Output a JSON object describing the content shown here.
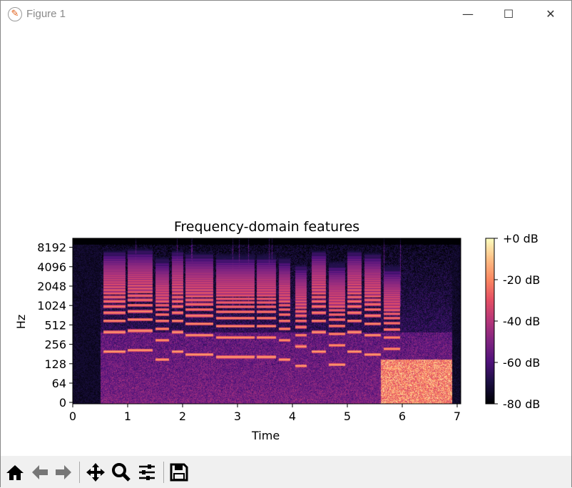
{
  "window": {
    "title": "Figure 1",
    "app_icon": "matplotlib-icon",
    "controls": [
      "minimize",
      "maximize",
      "close"
    ]
  },
  "toolbar": {
    "buttons": [
      "home-icon",
      "back-icon",
      "forward-icon",
      "pan-icon",
      "zoom-icon",
      "configure-subplots-icon",
      "save-icon"
    ]
  },
  "chart_data": {
    "type": "heatmap",
    "title": "Frequency-domain features",
    "xlabel": "Time",
    "ylabel": "Hz",
    "xlim": [
      0,
      7.06
    ],
    "ylim": [
      0,
      11025
    ],
    "yscale": "log (linear below 64)",
    "xticks": [
      "0",
      "1",
      "2",
      "3",
      "4",
      "5",
      "6",
      "7"
    ],
    "yticks": [
      "0",
      "64",
      "128",
      "256",
      "512",
      "1024",
      "2048",
      "4096",
      "8192"
    ],
    "colormap": "magma",
    "colorbar": {
      "range_db": [
        -80,
        0
      ],
      "ticks": [
        "+0 dB",
        "-20 dB",
        "-40 dB",
        "-60 dB",
        "-80 dB"
      ]
    },
    "note_segments": [
      {
        "start": 0.55,
        "end": 0.95,
        "f0_hz": 200
      },
      {
        "start": 1.0,
        "end": 1.45,
        "f0_hz": 210
      },
      {
        "start": 1.5,
        "end": 1.75,
        "f0_hz": 150
      },
      {
        "start": 1.8,
        "end": 2.0,
        "f0_hz": 200
      },
      {
        "start": 2.05,
        "end": 2.55,
        "f0_hz": 180
      },
      {
        "start": 2.6,
        "end": 3.3,
        "f0_hz": 165
      },
      {
        "start": 3.35,
        "end": 3.7,
        "f0_hz": 165
      },
      {
        "start": 3.75,
        "end": 3.95,
        "f0_hz": 150
      },
      {
        "start": 4.05,
        "end": 4.25,
        "f0_hz": 120
      },
      {
        "start": 4.35,
        "end": 4.6,
        "f0_hz": 200
      },
      {
        "start": 4.65,
        "end": 4.95,
        "f0_hz": 125
      },
      {
        "start": 5.0,
        "end": 5.25,
        "f0_hz": 200
      },
      {
        "start": 5.3,
        "end": 5.6,
        "f0_hz": 180
      },
      {
        "start": 5.65,
        "end": 5.95,
        "f0_hz": 110
      }
    ]
  }
}
